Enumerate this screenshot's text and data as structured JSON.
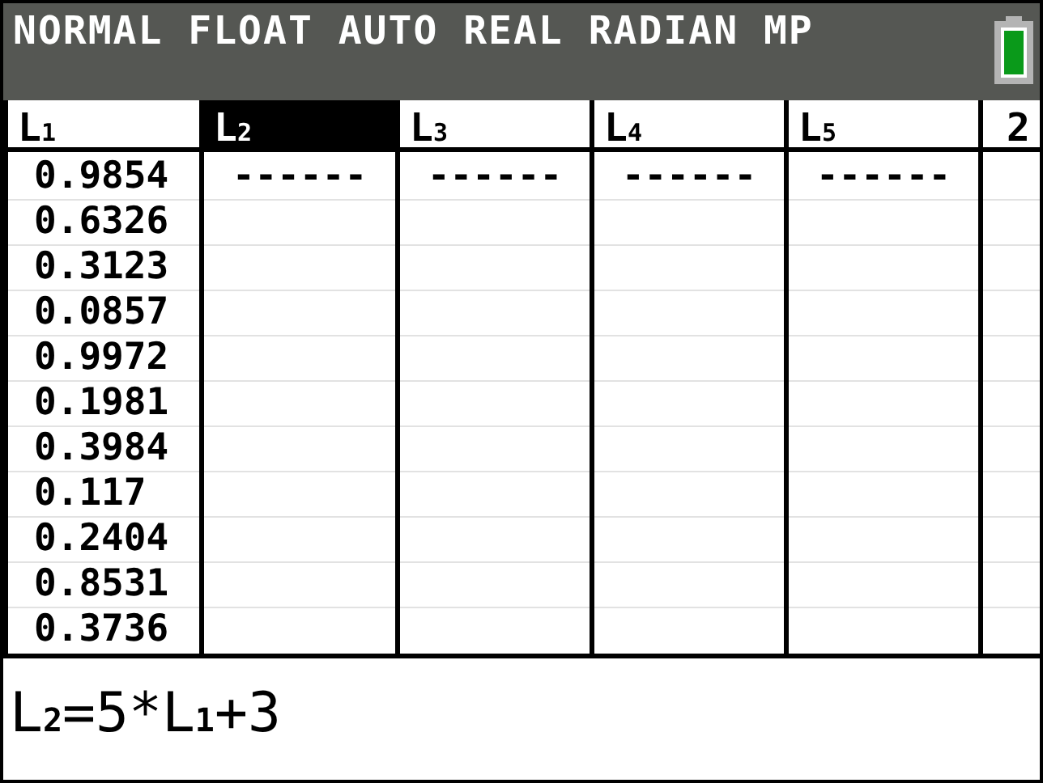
{
  "status_bar": {
    "mode": "NORMAL FLOAT AUTO REAL RADIAN MP"
  },
  "columns": [
    {
      "label": "L$_{1}$",
      "selected": false,
      "cells": [
        "0.9854",
        "0.6326",
        "0.3123",
        "0.0857",
        "0.9972",
        "0.1981",
        "0.3984",
        "0.117",
        "0.2404",
        "0.8531",
        "0.3736"
      ]
    },
    {
      "label": "L$_{2}$",
      "selected": true,
      "cells": [
        "------"
      ]
    },
    {
      "label": "L$_{3}$",
      "selected": false,
      "cells": [
        "------"
      ]
    },
    {
      "label": "L$_{4}$",
      "selected": false,
      "cells": [
        "------"
      ]
    },
    {
      "label": "L$_{5}$",
      "selected": false,
      "cells": [
        "------"
      ]
    },
    {
      "label": "2",
      "selected": false
    }
  ],
  "entry_line": "L$_{2}$=5*L$_{1}$+3"
}
